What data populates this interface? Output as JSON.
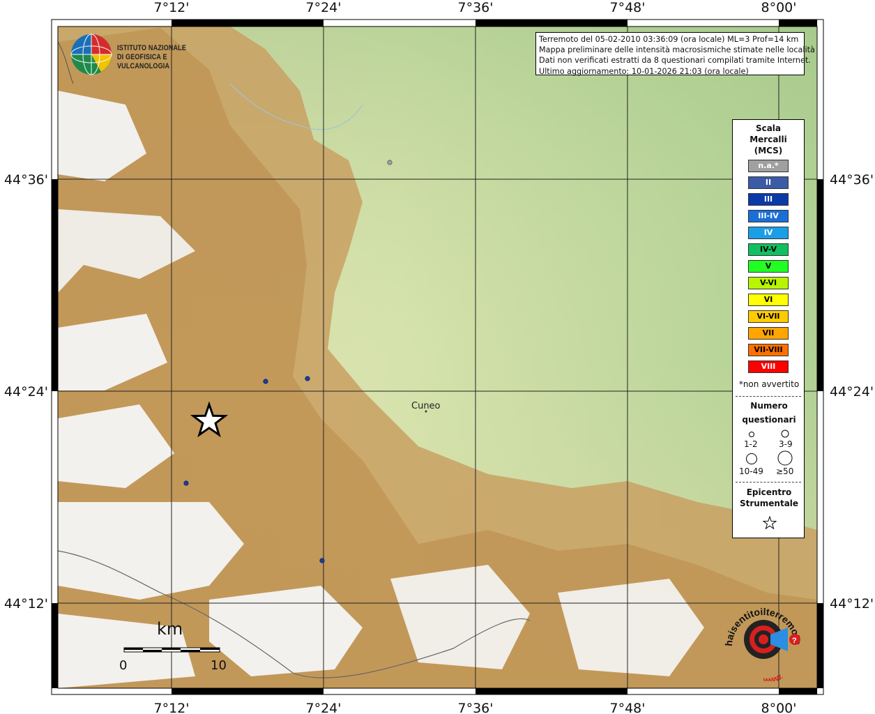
{
  "map": {
    "top_lon_labels": [
      "7°12'",
      "7°24'",
      "7°36'",
      "7°48'",
      "8°00'"
    ],
    "bottom_lon_labels": [
      "7°12'",
      "7°24'",
      "7°36'",
      "7°48'",
      "8°00'"
    ],
    "left_lat_labels": [
      "44°36'",
      "44°24'",
      "44°12'"
    ],
    "right_lat_labels": [
      "44°36'",
      "44°24'",
      "44°12'"
    ]
  },
  "header": {
    "line1": "Terremoto del 05-02-2010 03:36:09 (ora locale) ML=3 Prof=14 km",
    "line2": "Mappa preliminare delle intensità macrosismiche stimate nelle località",
    "line3": "Dati non verificati estratti da 8 questionari compilati tramite Internet.",
    "line4": "Ultimo aggiornamento: 10-01-2026 21:03 (ora locale)"
  },
  "logo": {
    "line1": "ISTITUTO NAZIONALE",
    "line2": "DI GEOFISICA E VULCANOLOGIA"
  },
  "legend": {
    "title": [
      "Scala",
      "Mercalli",
      "(MCS)"
    ],
    "items": [
      {
        "label": "n.a.*",
        "color": "#a0a0a0",
        "text_color": "#ffffff"
      },
      {
        "label": "II",
        "color": "#3b5aa8",
        "text_color": "#ffffff"
      },
      {
        "label": "III",
        "color": "#0a3aa8",
        "text_color": "#ffffff"
      },
      {
        "label": "III-IV",
        "color": "#1a6fd6",
        "text_color": "#ffffff"
      },
      {
        "label": "IV",
        "color": "#1a9fe6",
        "text_color": "#ffffff"
      },
      {
        "label": "IV-V",
        "color": "#10c060",
        "text_color": "#000000"
      },
      {
        "label": "V",
        "color": "#22ff22",
        "text_color": "#000000"
      },
      {
        "label": "V-VI",
        "color": "#b8f500",
        "text_color": "#000000"
      },
      {
        "label": "VI",
        "color": "#ffff00",
        "text_color": "#000000"
      },
      {
        "label": "VI-VII",
        "color": "#ffcc00",
        "text_color": "#000000"
      },
      {
        "label": "VII",
        "color": "#ffa500",
        "text_color": "#000000"
      },
      {
        "label": "VII-VIII",
        "color": "#ff7000",
        "text_color": "#000000"
      },
      {
        "label": "VIII",
        "color": "#ff0000",
        "text_color": "#ffffff"
      }
    ],
    "note": "*non avvertito",
    "count_title": [
      "Numero",
      "questionari"
    ],
    "count_sizes": [
      "1-2",
      "3-9",
      "10-49",
      "≥50"
    ],
    "epicenter_title": [
      "Epicentro",
      "Strumentale"
    ]
  },
  "places": {
    "city": "Cuneo"
  },
  "scalebar": {
    "unit": "km",
    "start": "0",
    "end": "10"
  },
  "brand": {
    "text": "haisentitoilterremoto.it",
    "url_text": "WWW."
  }
}
